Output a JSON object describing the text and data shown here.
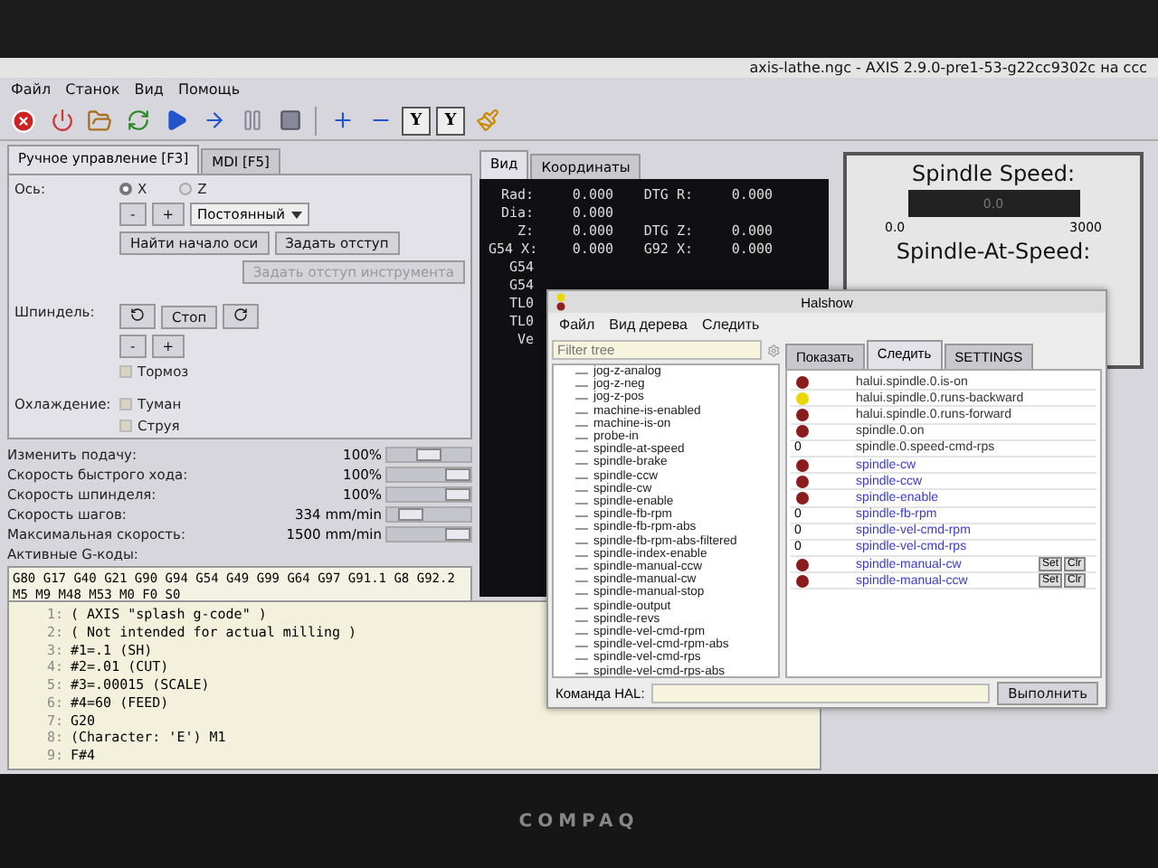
{
  "title_bar": {
    "title": "axis-lathe.ngc - AXIS 2.9.0-pre1-53-g22cc9302c на ccc"
  },
  "menu": [
    "Файл",
    "Станок",
    "Вид",
    "Помощь"
  ],
  "toolbar": {
    "view_buttons": [
      "Y",
      "Y"
    ]
  },
  "tabs": [
    {
      "label": "Ручное управление [F3]",
      "selected": true
    },
    {
      "label": "MDI [F5]",
      "selected": false
    }
  ],
  "manual": {
    "axis_label": "Ось:",
    "axes": [
      {
        "label": "X",
        "selected": true
      },
      {
        "label": "Z",
        "selected": false
      }
    ],
    "jog_minus": "-",
    "jog_plus": "+",
    "jog_mode": "Постоянный",
    "home_button": "Найти начало оси",
    "touch_off_button": "Задать отступ",
    "tool_touch_off": {
      "label": "Задать отступ инструмента",
      "disabled": true
    },
    "spindle_label": "Шпиндель:",
    "spindle_stop": "Стоп",
    "spindle_minus": "-",
    "spindle_plus": "+",
    "brake": {
      "label": "Тормоз",
      "checked": false
    },
    "coolant_label": "Охлаждение:",
    "coolant": [
      {
        "label": "Туман",
        "checked": false
      },
      {
        "label": "Струя",
        "checked": false
      }
    ]
  },
  "overrides": [
    {
      "label": "Изменить подачу:",
      "reading": "100%",
      "level": 0.5
    },
    {
      "label": "Скорость быстрого хода:",
      "reading": "100%",
      "level": 1
    },
    {
      "label": "Скорость шпинделя:",
      "reading": "100%",
      "level": 1
    },
    {
      "label": "Скорость шагов:",
      "reading": "334 mm/min",
      "level": 0.2
    },
    {
      "label": "Максимальная скорость:",
      "reading": "1500 mm/min",
      "level": 1
    }
  ],
  "active_gcodes": {
    "label": "Активные G-коды:",
    "text": "G80 G17 G40 G21 G90 G94 G54 G49 G99 G64 G97 G91.1 G8 G92.2 M5 M9 M48 M53 M0 F0 S0"
  },
  "gcode": [
    {
      "number": "1:",
      "text": "( AXIS \"splash g-code\" )"
    },
    {
      "number": "2:",
      "text": "( Not intended for actual milling )"
    },
    {
      "number": "3:",
      "text": "#1=.1 (SH)"
    },
    {
      "number": "4:",
      "text": "#2=.01 (CUT)"
    },
    {
      "number": "5:",
      "text": "#3=.00015 (SCALE)"
    },
    {
      "number": "6:",
      "text": "#4=60 (FEED)"
    },
    {
      "number": "7:",
      "text": "G20"
    },
    {
      "number": "8:",
      "text": "(Character: 'E') M1"
    },
    {
      "number": "9:",
      "text": "F#4"
    }
  ],
  "dro_tabs": [
    {
      "label": "Вид",
      "selected": true
    },
    {
      "label": "Координаты",
      "selected": false
    }
  ],
  "dro": [
    {
      "label": "Rad:",
      "value": "0.000",
      "label_2": "DTG R:",
      "value_2": "0.000"
    },
    {
      "label": "Dia:",
      "value": "0.000"
    },
    {
      "label": "Z:",
      "value": "0.000",
      "label_2": "DTG Z:",
      "value_2": "0.000"
    },
    {
      "label": "G54 X:",
      "value": "0.000",
      "label_2": "G92 X:",
      "value_2": "0.000"
    },
    {
      "label": "G54"
    },
    {
      "label": "G54"
    },
    {
      "label": "TL0"
    },
    {
      "label": "TL0"
    },
    {
      "label": "Ve"
    }
  ],
  "pyvcp": {
    "speed_title": "Spindle Speed:",
    "speed_value": "0.0",
    "scale_min": "0.0",
    "scale_max": "3000",
    "at_speed_title": "Spindle-At-Speed:"
  },
  "halshow": {
    "title": "Halshow",
    "menu": [
      "Файл",
      "Вид дерева",
      "Следить"
    ],
    "filter_placeholder": "Filter tree",
    "tree": [
      "jog-z-analog",
      "jog-z-neg",
      "jog-z-pos",
      "machine-is-enabled",
      "machine-is-on",
      "probe-in",
      "spindle-at-speed",
      "spindle-brake",
      "spindle-ccw",
      "spindle-cw",
      "spindle-enable",
      "spindle-fb-rpm",
      "spindle-fb-rpm-abs",
      "spindle-fb-rpm-abs-filtered",
      "spindle-index-enable",
      "spindle-manual-ccw",
      "spindle-manual-cw",
      "spindle-manual-stop",
      "spindle-output",
      "spindle-revs",
      "spindle-vel-cmd-rpm",
      "spindle-vel-cmd-rpm-abs",
      "spindle-vel-cmd-rps",
      "spindle-vel-cmd-rps-abs"
    ],
    "tabs": [
      {
        "label": "Показать",
        "selected": false
      },
      {
        "label": "Следить",
        "selected": true
      },
      {
        "label": "SETTINGS",
        "selected": false
      }
    ],
    "watch": [
      {
        "kind": "bit",
        "on": false,
        "signal": false,
        "name": "halui.spindle.0.is-on"
      },
      {
        "kind": "bit",
        "on": true,
        "signal": false,
        "name": "halui.spindle.0.runs-backward"
      },
      {
        "kind": "bit",
        "on": false,
        "signal": false,
        "name": "halui.spindle.0.runs-forward"
      },
      {
        "kind": "bit",
        "on": false,
        "signal": false,
        "name": "spindle.0.on"
      },
      {
        "kind": "value",
        "value": "0",
        "signal": false,
        "name": "spindle.0.speed-cmd-rps"
      },
      {
        "kind": "bit",
        "on": false,
        "signal": true,
        "name": "spindle-cw"
      },
      {
        "kind": "bit",
        "on": false,
        "signal": true,
        "name": "spindle-ccw"
      },
      {
        "kind": "bit",
        "on": false,
        "signal": true,
        "name": "spindle-enable"
      },
      {
        "kind": "value",
        "value": "0",
        "signal": true,
        "name": "spindle-fb-rpm"
      },
      {
        "kind": "value",
        "value": "0",
        "signal": true,
        "name": "spindle-vel-cmd-rpm"
      },
      {
        "kind": "value",
        "value": "0",
        "signal": true,
        "name": "spindle-vel-cmd-rps"
      },
      {
        "kind": "bit",
        "on": false,
        "signal": true,
        "name": "spindle-manual-cw",
        "buttons": [
          "Set",
          "Clr"
        ]
      },
      {
        "kind": "bit",
        "on": false,
        "signal": true,
        "name": "spindle-manual-ccw",
        "buttons": [
          "Set",
          "Clr"
        ]
      }
    ],
    "command_label": "Команда HAL:",
    "execute_button": "Выполнить"
  },
  "bezel": {
    "logo": "COMPAQ"
  }
}
